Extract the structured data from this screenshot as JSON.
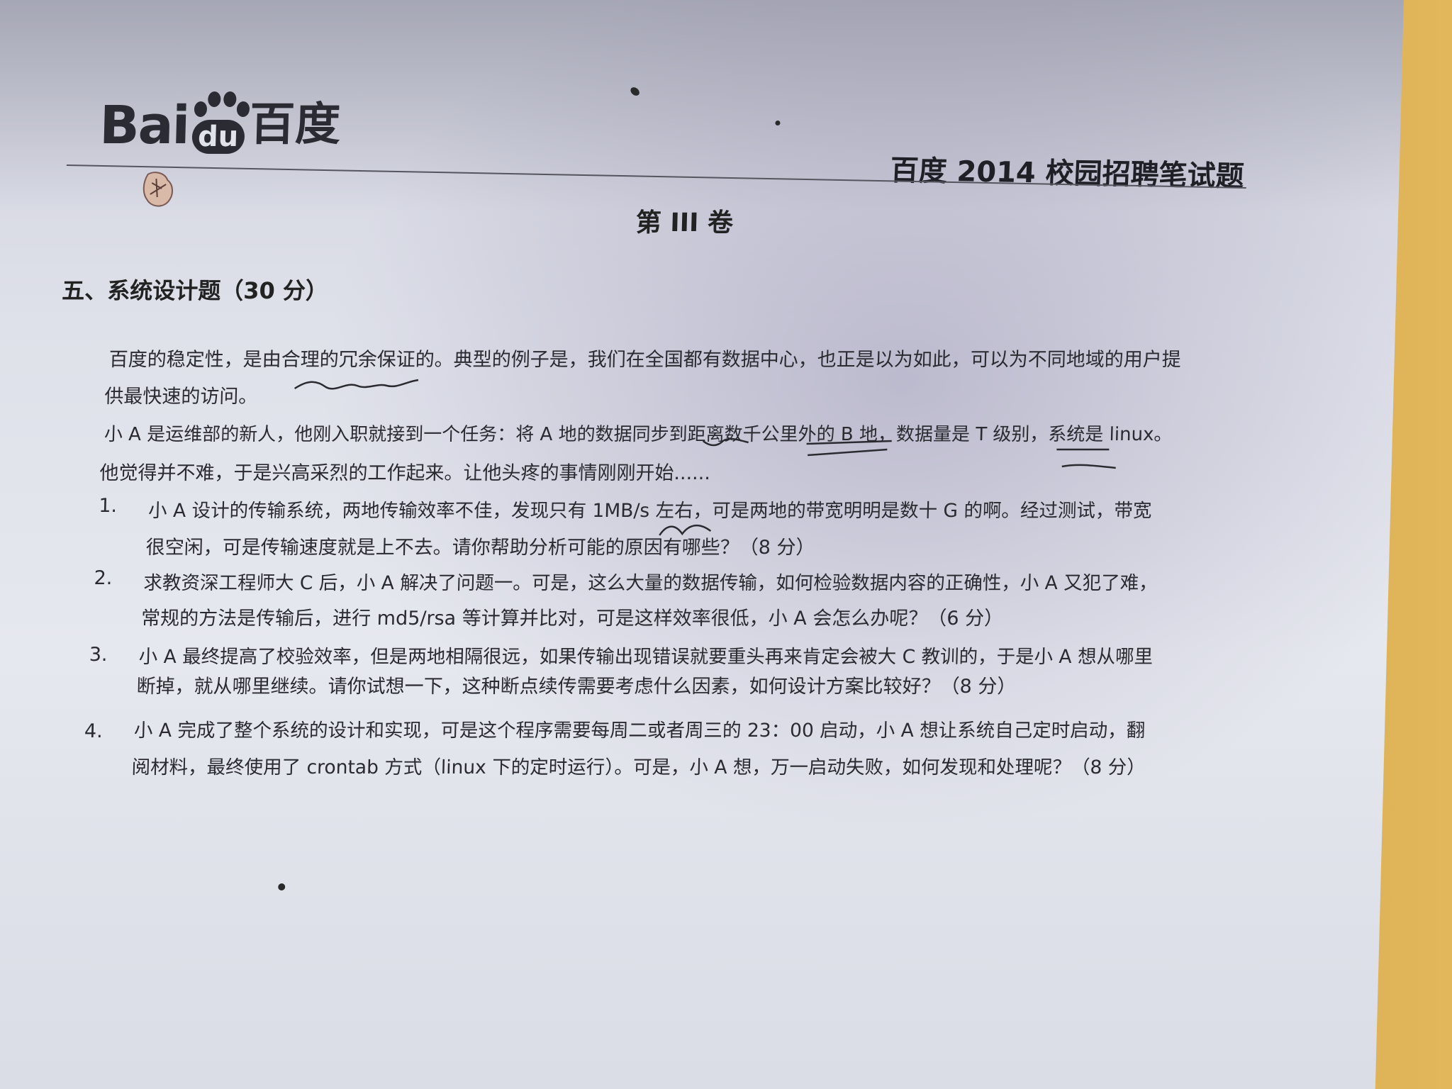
{
  "header": {
    "logo_latin": "Bai",
    "logo_du": "du",
    "logo_cn": "百度",
    "title": "百度 2014 校园招聘笔试题"
  },
  "volume_title": "第 III 卷",
  "section": {
    "heading": "五、系统设计题（30 分）"
  },
  "intro": {
    "line1": "百度的稳定性，是由合理的冗余保证的。典型的例子是，我们在全国都有数据中心，也正是以为如此，可以为不同地域的用户提",
    "line2": "供最快速的访问。",
    "line3": "小 A 是运维部的新人，他刚入职就接到一个任务：将 A 地的数据同步到距离数千公里外的 B 地，数据量是 T 级别，系统是 linux。",
    "line4": "他觉得并不难，于是兴高采烈的工作起来。让他头疼的事情刚刚开始......"
  },
  "questions": [
    {
      "number": "1.",
      "line1": "小 A 设计的传输系统，两地传输效率不佳，发现只有 1MB/s 左右，可是两地的带宽明明是数十 G 的啊。经过测试，带宽",
      "line2": "很空闲，可是传输速度就是上不去。请你帮助分析可能的原因有哪些？（8 分）"
    },
    {
      "number": "2.",
      "line1": "求教资深工程师大 C 后，小 A 解决了问题一。可是，这么大量的数据传输，如何检验数据内容的正确性，小 A 又犯了难，",
      "line2": "常规的方法是传输后，进行 md5/rsa 等计算并比对，可是这样效率很低，小 A 会怎么办呢？（6 分）"
    },
    {
      "number": "3.",
      "line1": "小 A 最终提高了校验效率，但是两地相隔很远，如果传输出现错误就要重头再来肯定会被大 C 教训的，于是小 A 想从哪里",
      "line2": "断掉，就从哪里继续。请你试想一下，这种断点续传需要考虑什么因素，如何设计方案比较好？（8 分）"
    },
    {
      "number": "4.",
      "line1": "小 A 完成了整个系统的设计和实现，可是这个程序需要每周二或者周三的 23：00 启动，小 A 想让系统自己定时启动，翻",
      "line2": "阅材料，最终使用了 crontab 方式（linux 下的定时运行）。可是，小 A 想，万一启动失败，如何发现和处理呢？（8 分）"
    }
  ],
  "colors": {
    "ink": "#2a2a30",
    "paper": "#e2e4ec",
    "desk": "#d9ad52"
  }
}
